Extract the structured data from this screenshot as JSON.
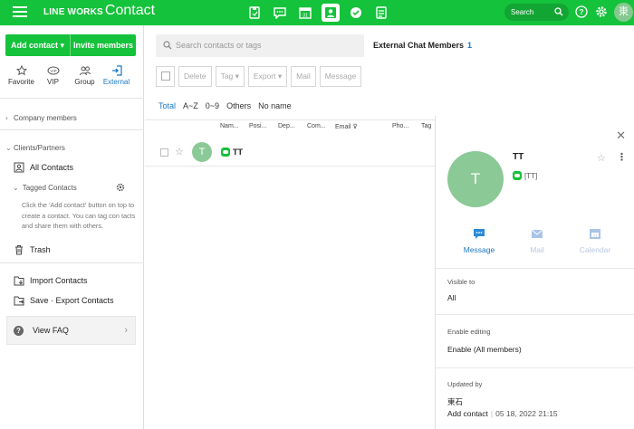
{
  "header": {
    "brand_bold": "LINE WORKS",
    "brand_product": "Contact",
    "app_icons": [
      "note-icon",
      "chat-icon",
      "calendar-icon",
      "contact-icon",
      "task-icon",
      "board-icon"
    ],
    "search_label": "Search",
    "avatar_initial": "東",
    "accent_color": "#15c23b"
  },
  "sidebar": {
    "add_contact": "Add contact ▾",
    "invite_members": "Invite members",
    "quick_tabs": [
      {
        "label": "Favorite",
        "icon": "star-icon"
      },
      {
        "label": "VIP",
        "icon": "vip-icon"
      },
      {
        "label": "Group",
        "icon": "group-icon"
      },
      {
        "label": "External",
        "icon": "external-icon",
        "selected": true
      }
    ],
    "company_members": "Company members",
    "clients_partners": "Clients/Partners",
    "all_contacts": "All Contacts",
    "tagged_contacts": "Tagged Contacts",
    "tagged_hint": "Click the 'Add contact' button on top to create a contact. You can tag con tacts and share them with others.",
    "trash": "Trash",
    "import_contacts": "Import Contacts",
    "save_export": "Save · Export Contacts",
    "view_faq": "View FAQ"
  },
  "main": {
    "search_placeholder": "Search contacts or tags",
    "external_title": "External Chat Members",
    "external_count": "1",
    "toolbar": {
      "delete": "Delete",
      "tag": "Tag ▾",
      "export": "Export ▾",
      "mail": "Mail",
      "message": "Message"
    },
    "filters": [
      "Total",
      "A~Z",
      "0~9",
      "Others",
      "No name"
    ],
    "columns": [
      "Nam...",
      "Posi...",
      "Dep...",
      "Com...",
      "Email",
      "Pho...",
      "Tag"
    ],
    "rows": [
      {
        "initial": "T",
        "name": "TT"
      }
    ]
  },
  "detail": {
    "initial": "T",
    "name": "TT",
    "tag": "[TT]",
    "actions": {
      "message": "Message",
      "mail": "Mail",
      "calendar": "Calendar"
    },
    "visible_to_label": "Visible to",
    "visible_to_value": "All",
    "enable_editing_label": "Enable editing",
    "enable_editing_value": "Enable (All members)",
    "updated_by_label": "Updated by",
    "updated_by_name": "東石",
    "updated_action": "Add contact",
    "updated_time": "05 18, 2022 21:15"
  }
}
